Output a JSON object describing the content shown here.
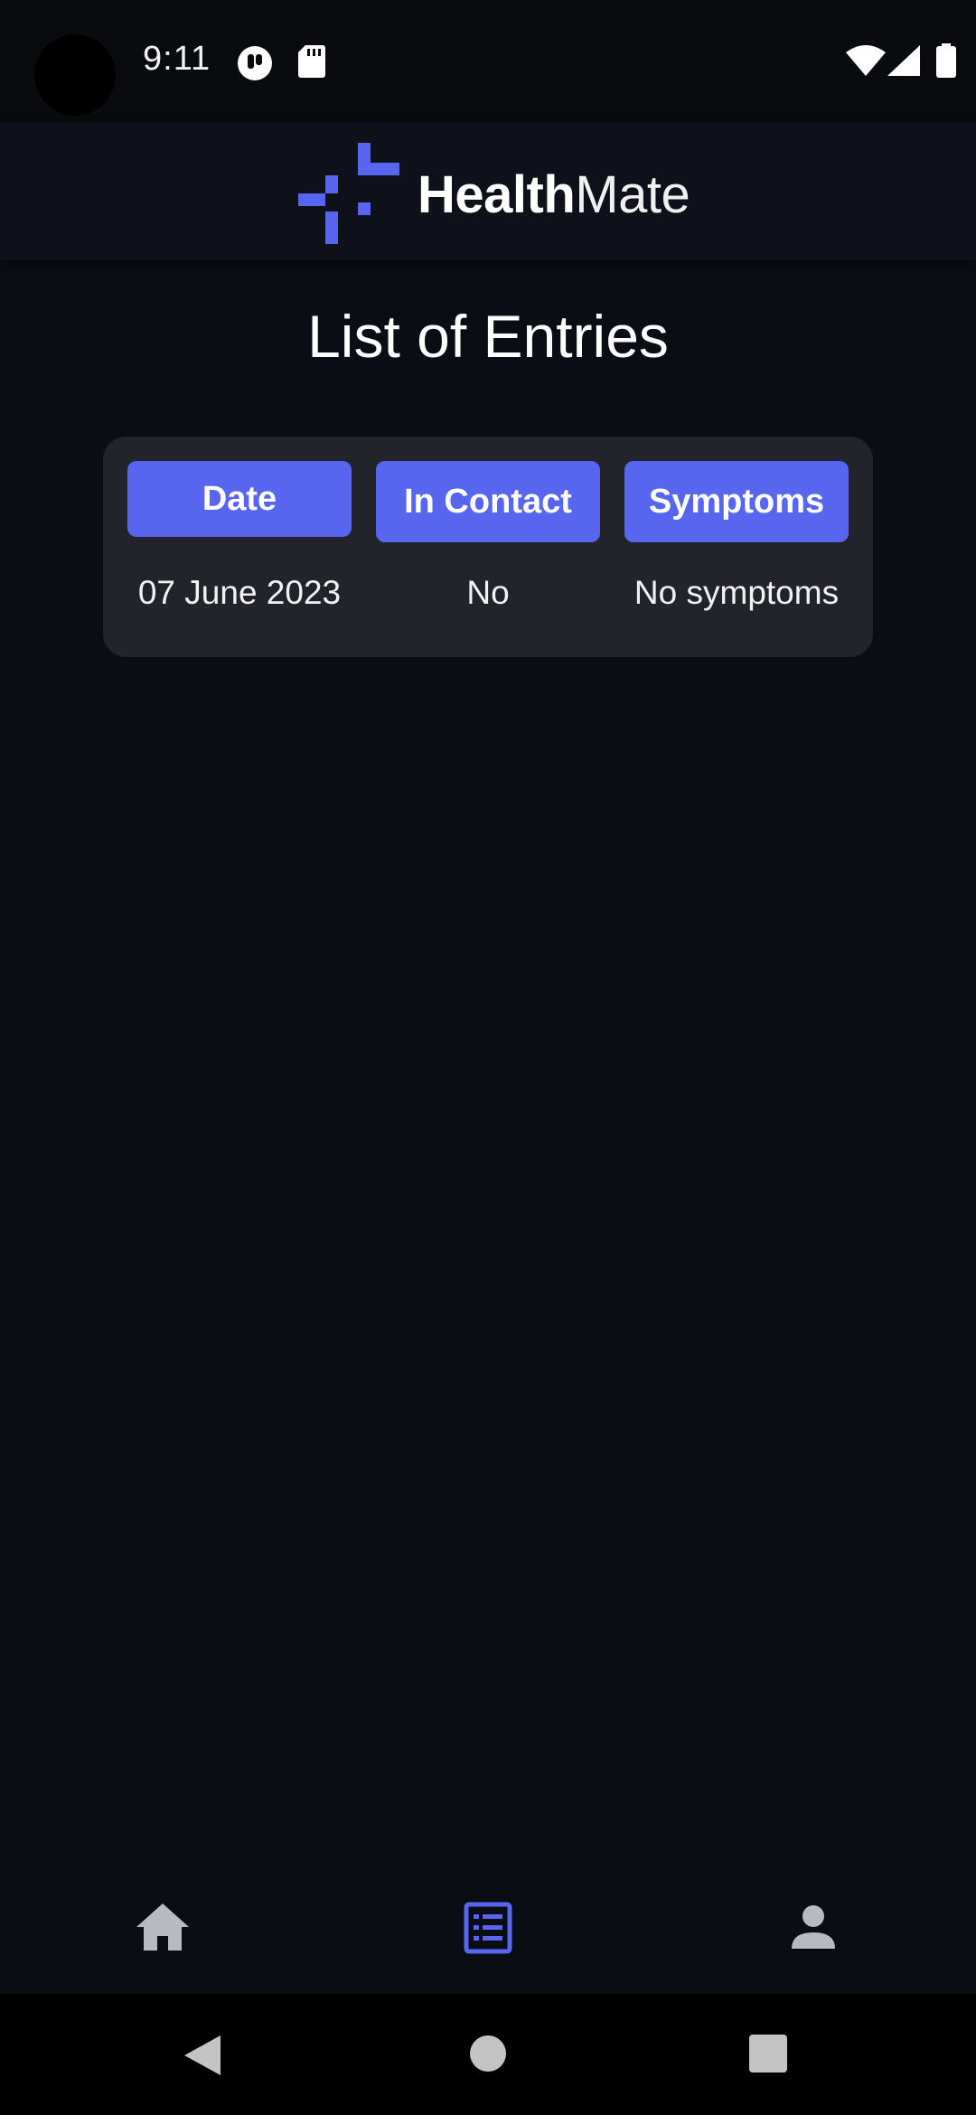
{
  "status_bar": {
    "time": "9:11",
    "icons": [
      "tracking-icon",
      "sd-card-icon",
      "wifi-icon",
      "cell-signal-icon",
      "battery-icon"
    ]
  },
  "header": {
    "brand_bold": "Health",
    "brand_light": "Mate",
    "brand_color": "#5865ee"
  },
  "page": {
    "title": "List of Entries"
  },
  "table": {
    "columns": [
      "Date",
      "In Contact",
      "Symptoms"
    ],
    "rows": [
      [
        "07 June 2023",
        "No",
        "No symptoms"
      ]
    ],
    "header_color": "#5865ee"
  },
  "bottom_nav": {
    "items": [
      "home-icon",
      "list-icon",
      "profile-icon"
    ],
    "active": "list-icon",
    "active_color": "#5865ee",
    "inactive_color": "#b9bac0"
  },
  "system_nav": {
    "buttons": [
      "back-icon",
      "home-circle-icon",
      "recents-icon"
    ]
  }
}
